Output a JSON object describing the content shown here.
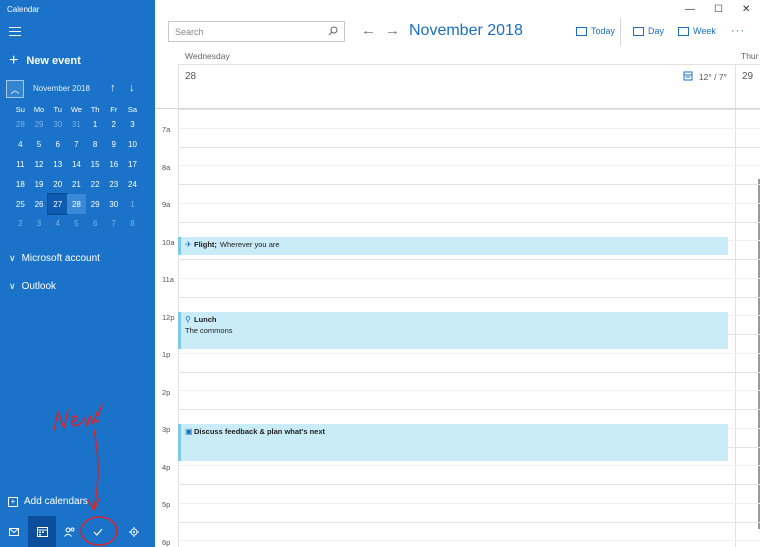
{
  "window": {
    "title": "Calendar",
    "controls": {
      "minimize": "—",
      "maximize": "☐",
      "close": "✕"
    }
  },
  "sidebar": {
    "new_event_label": "New event",
    "mini_calendar": {
      "month_label": "November 2018",
      "weekdays": [
        "Su",
        "Mo",
        "Tu",
        "We",
        "Th",
        "Fr",
        "Sa"
      ],
      "weeks": [
        [
          "28",
          "29",
          "30",
          "31",
          "1",
          "2",
          "3"
        ],
        [
          "4",
          "5",
          "6",
          "7",
          "8",
          "9",
          "10"
        ],
        [
          "11",
          "12",
          "13",
          "14",
          "15",
          "16",
          "17"
        ],
        [
          "18",
          "19",
          "20",
          "21",
          "22",
          "23",
          "24"
        ],
        [
          "25",
          "26",
          "27",
          "28",
          "29",
          "30",
          "1"
        ],
        [
          "2",
          "3",
          "4",
          "5",
          "6",
          "7",
          "8"
        ]
      ],
      "today": "27",
      "selected": "28"
    },
    "accounts": [
      "Microsoft account",
      "Outlook"
    ],
    "add_calendars_label": "Add calendars",
    "bottom_icons": [
      "mail-icon",
      "calendar-icon",
      "people-icon",
      "todo-icon",
      "settings-icon"
    ],
    "annotation_text": "New!"
  },
  "toolbar": {
    "search_placeholder": "Search",
    "month_title": "November 2018",
    "today_label": "Today",
    "day_label": "Day",
    "week_label": "Week",
    "more_label": "···"
  },
  "day_view": {
    "day_name": "Wednesday",
    "date": "28",
    "weather": "12° / 7°",
    "next_day_name": "Thur",
    "next_date": "29",
    "hours": [
      "7a",
      "8a",
      "9a",
      "10a",
      "11a",
      "12p",
      "1p",
      "2p",
      "3p",
      "4p",
      "5p",
      "6p"
    ],
    "events": [
      {
        "title": "Flight;",
        "location": "Wherever you are",
        "icon": "airplane-icon",
        "start_hour": "10a"
      },
      {
        "title": "Lunch",
        "location": "The commons",
        "icon": "fork-knife-icon",
        "start_hour": "12p"
      },
      {
        "title": "Discuss feedback & plan what's next",
        "location": "",
        "icon": "chat-icon",
        "start_hour": "3p"
      }
    ]
  },
  "colors": {
    "sidebar_bg": "#1a73c9",
    "accent": "#1a6fc4",
    "event_bg": "#c9ecf8",
    "annotation": "#d6262c"
  }
}
